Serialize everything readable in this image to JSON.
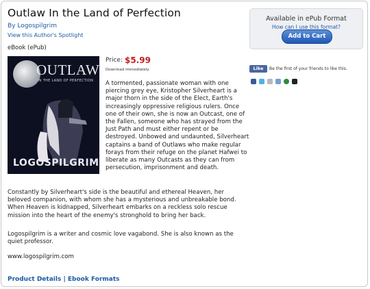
{
  "product": {
    "title": "Outlaw In the Land of Perfection",
    "byline": "By Logospilgrim",
    "spotlight": "View this Author's Spotlight",
    "format": "eBook (ePub)"
  },
  "buybox": {
    "available": "Available in ePub Format",
    "howto": "How can I use this format?",
    "cart_button": "Add to Cart"
  },
  "cover": {
    "title": "OUTLAW",
    "subtitle": "IN THE LAND OF PERFECTION",
    "author": "LOGOSPILGRIM"
  },
  "price": {
    "label": "Price:",
    "value": "$5.99",
    "note": "Download immediately."
  },
  "description": {
    "paragraph1": "A tormented, passionate woman with one piercing grey eye, Kristopher Silverheart is a major thorn in the side of the Elect, Earth's increasingly oppressive religious rulers. Once one of their own, she is now an Outcast, one of the Fallen, someone who has strayed from the Just Path and must either repent or be destroyed. Unbowed and undaunted, Silverheart captains a band of Outlaws who make regular forays from their refuge on the planet Hafwei to liberate as many Outcasts as they can from persecution, imprisonment and death.",
    "paragraph2": "Constantly by Silverheart's side is the beautiful and ethereal Heaven, her beloved companion, with whom she has a mysterious and unbreakable bond. When Heaven is kidnapped, Silverheart embarks on a reckless solo rescue mission into the heart of the enemy's stronghold to bring her back.",
    "paragraph3": "Logospilgrim is a writer and cosmic love vagabond. She is also known as the quiet professor.",
    "website": "www.logospilgrim.com"
  },
  "social": {
    "like_button": "Like",
    "like_text": "Be the first of your friends to like this."
  },
  "footer": {
    "product_details": "Product Details",
    "separator": "|",
    "ebook_formats": "Ebook Formats"
  },
  "colors": {
    "link": "#1c5aa3",
    "price": "#c22020",
    "button": "#1f58b5"
  }
}
